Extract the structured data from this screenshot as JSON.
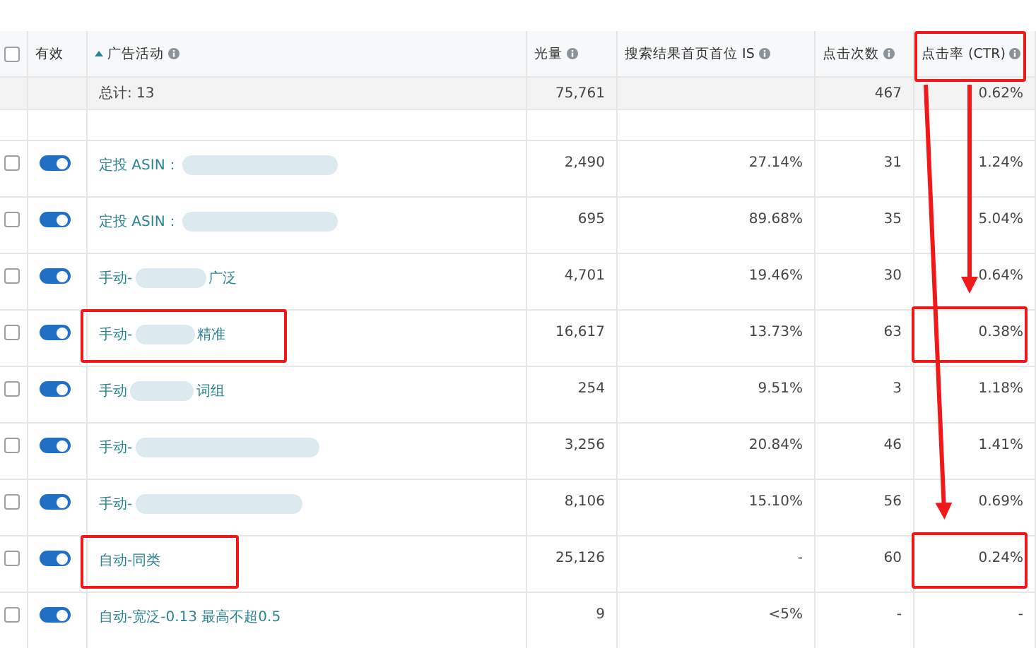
{
  "select_all": {
    "checked": false
  },
  "columns": [
    {
      "label": "有效"
    },
    {
      "label": "广告活动",
      "info": true,
      "sort": true
    },
    {
      "label": "光量",
      "info": true
    },
    {
      "label": "搜索结果首页首位 IS",
      "info": true
    },
    {
      "label": "点击次数",
      "info": true
    },
    {
      "label": "点击率 (CTR)",
      "info": true,
      "highlighted": true
    }
  ],
  "total": {
    "label": "总计: 13",
    "impressions": "75,761",
    "clicks": "467",
    "ctr": "0.62%"
  },
  "rows": [
    {
      "checked": false,
      "enabled": true,
      "prefix": "定投 ASIN：",
      "redacted": true,
      "impressions": "2,490",
      "top_is": "27.14%",
      "clicks": "31",
      "ctr": "1.24%"
    },
    {
      "checked": false,
      "enabled": true,
      "prefix": "定投 ASIN：",
      "redacted": true,
      "impressions": "695",
      "top_is": "89.68%",
      "clicks": "35",
      "ctr": "5.04%"
    },
    {
      "checked": false,
      "enabled": true,
      "prefix": "手动-",
      "redacted": true,
      "suffix": "广泛",
      "impressions": "4,701",
      "top_is": "19.46%",
      "clicks": "30",
      "ctr": "0.64%"
    },
    {
      "checked": false,
      "enabled": true,
      "prefix": "手动-",
      "redacted": true,
      "suffix": "精准",
      "impressions": "16,617",
      "top_is": "13.73%",
      "clicks": "63",
      "ctr": "0.38%",
      "highlight_campaign": true,
      "highlight_ctr": true
    },
    {
      "checked": false,
      "enabled": true,
      "prefix": "手动",
      "redacted": true,
      "suffix": "词组",
      "impressions": "254",
      "top_is": "9.51%",
      "clicks": "3",
      "ctr": "1.18%"
    },
    {
      "checked": false,
      "enabled": true,
      "prefix": "手动-",
      "redacted": true,
      "impressions": "3,256",
      "top_is": "20.84%",
      "clicks": "46",
      "ctr": "1.41%"
    },
    {
      "checked": false,
      "enabled": true,
      "prefix": "手动-",
      "redacted": true,
      "impressions": "8,106",
      "top_is": "15.10%",
      "clicks": "56",
      "ctr": "0.69%"
    },
    {
      "checked": false,
      "enabled": true,
      "prefix": "自动-同类",
      "impressions": "25,126",
      "top_is": "-",
      "clicks": "60",
      "ctr": "0.24%",
      "highlight_campaign": true,
      "highlight_ctr": true
    },
    {
      "checked": false,
      "enabled": true,
      "prefix": "自动-宽泛-0.13 最高不超0.5",
      "impressions": "9",
      "top_is": "<5%",
      "clicks": "-",
      "ctr": "-"
    }
  ]
}
